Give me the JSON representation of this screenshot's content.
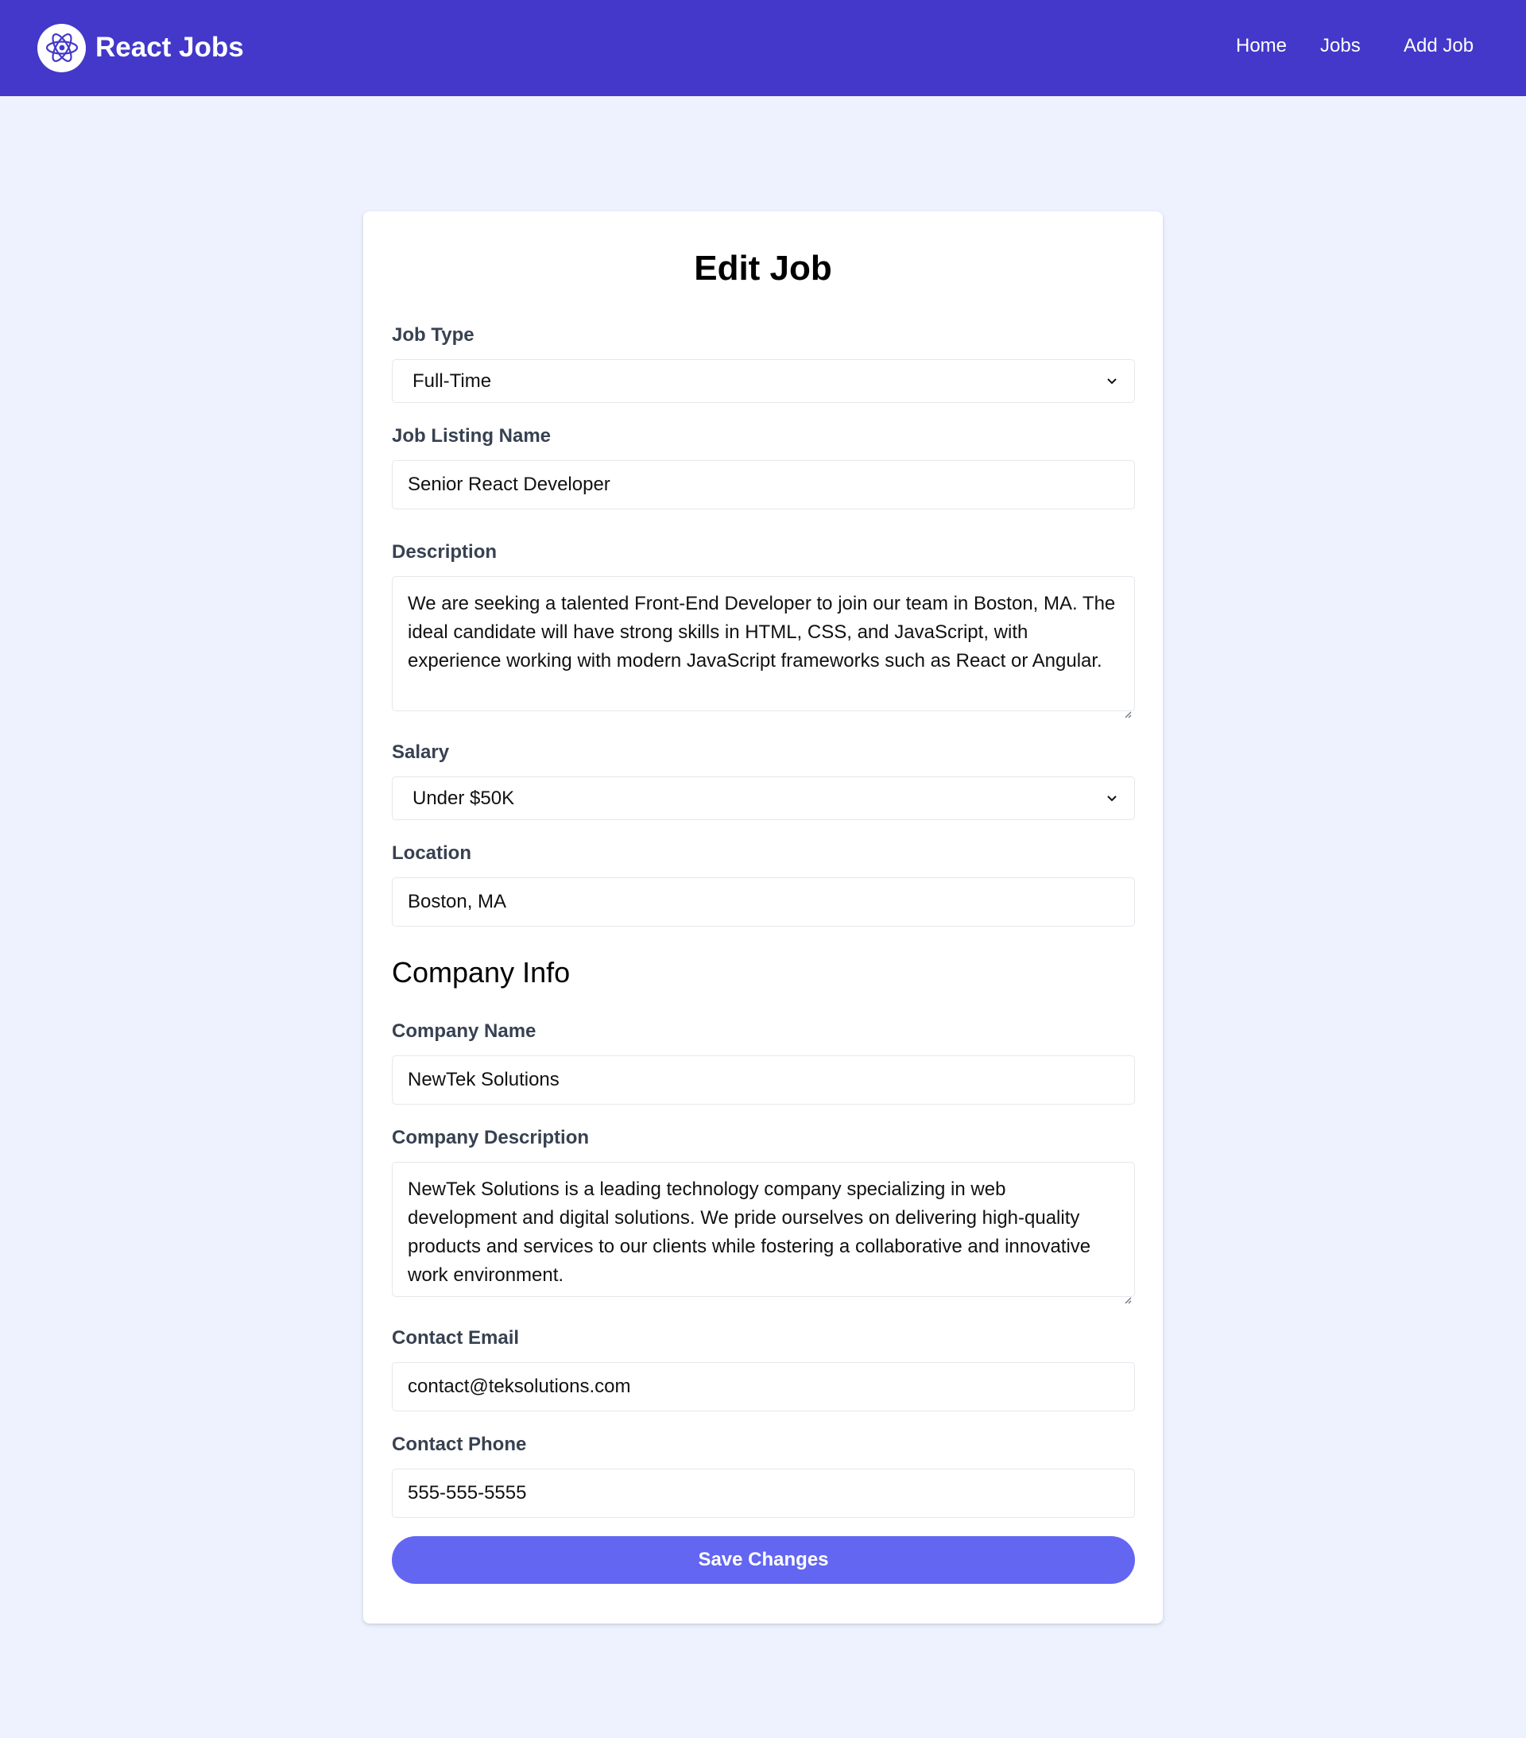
{
  "header": {
    "brand": "React Jobs",
    "logo_icon": "react-atom-icon",
    "nav": [
      {
        "label": "Home"
      },
      {
        "label": "Jobs"
      },
      {
        "label": "Add Job"
      }
    ]
  },
  "form": {
    "title": "Edit Job",
    "job_type": {
      "label": "Job Type",
      "value": "Full-Time"
    },
    "job_listing_name": {
      "label": "Job Listing Name",
      "value": "Senior React Developer"
    },
    "description": {
      "label": "Description",
      "value": "We are seeking a talented Front-End Developer to join our team in Boston, MA. The ideal candidate will have strong skills in HTML, CSS, and JavaScript, with experience working with modern JavaScript frameworks such as React or Angular."
    },
    "salary": {
      "label": "Salary",
      "value": "Under $50K"
    },
    "location": {
      "label": "Location",
      "value": "Boston, MA"
    },
    "company_section_title": "Company Info",
    "company_name": {
      "label": "Company Name",
      "value": "NewTek Solutions"
    },
    "company_description": {
      "label": "Company Description",
      "value": "NewTek Solutions is a leading technology company specializing in web development and digital solutions. We pride ourselves on delivering high-quality products and services to our clients while fostering a collaborative and innovative work environment."
    },
    "contact_email": {
      "label": "Contact Email",
      "value": "contact@teksolutions.com"
    },
    "contact_phone": {
      "label": "Contact Phone",
      "value": "555-555-5555"
    },
    "submit_label": "Save Changes"
  },
  "colors": {
    "navbar": "#4338ca",
    "page_background": "#eef2ff",
    "button": "#6366f1",
    "label": "#374151"
  }
}
